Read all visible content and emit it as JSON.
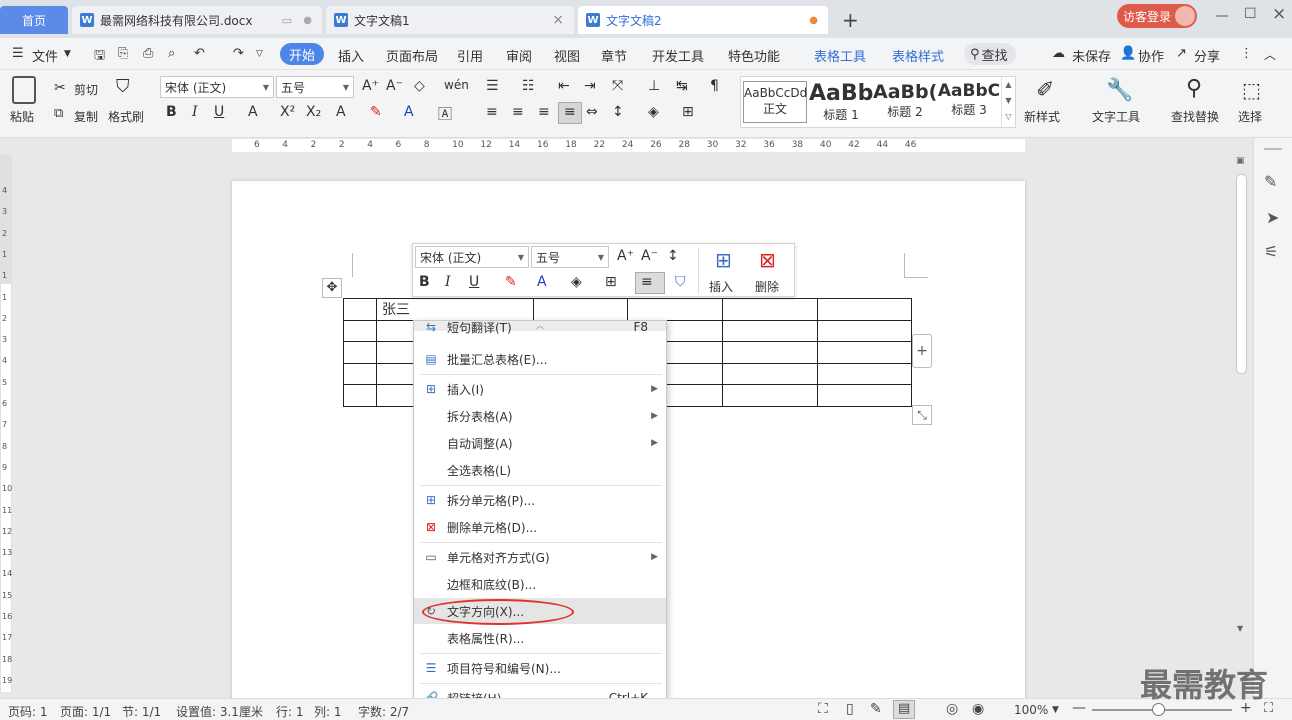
{
  "tabs": {
    "home": "首页",
    "tab1": "最需网络科技有限公司.docx",
    "tab2": "文字文稿1",
    "tab3": "文字文稿2",
    "new_tab": "+",
    "login": "访客登录"
  },
  "menu": {
    "file": "文件",
    "start": "开始",
    "insert": "插入",
    "layout": "页面布局",
    "ref": "引用",
    "review": "审阅",
    "view": "视图",
    "section": "章节",
    "dev": "开发工具",
    "special": "特色功能",
    "table_tools": "表格工具",
    "table_style": "表格样式",
    "search": "查找",
    "unsaved": "未保存",
    "collab": "协作",
    "share": "分享"
  },
  "toolbar": {
    "paste": "粘贴",
    "cut": "剪切",
    "copy": "复制",
    "format_painter": "格式刷",
    "font": "宋体 (正文)",
    "size": "五号",
    "style_normal_preview": "AaBbCcDd",
    "style_normal": "正文",
    "style_h1_preview": "AaBb",
    "style_h1": "标题 1",
    "style_h2_preview": "AaBb(",
    "style_h2": "标题 2",
    "style_h3_preview": "AaBbC",
    "style_h3": "标题 3",
    "new_style": "新样式",
    "text_tools": "文字工具",
    "find_replace": "查找替换",
    "select": "选择"
  },
  "ruler": {
    "ticks": [
      "6",
      "4",
      "2",
      "2",
      "4",
      "6",
      "8",
      "10",
      "12",
      "14",
      "16",
      "18",
      "22",
      "24",
      "26",
      "28",
      "30",
      "32",
      "36",
      "38",
      "40",
      "42",
      "44",
      "46"
    ],
    "vticks": [
      "4",
      "3",
      "2",
      "1",
      "1",
      "1",
      "2",
      "3",
      "4",
      "5",
      "6",
      "7",
      "8",
      "9",
      "10",
      "11",
      "12",
      "13",
      "14",
      "15",
      "16",
      "17",
      "18",
      "19"
    ]
  },
  "document": {
    "cell_text": "张三"
  },
  "floatbar": {
    "font": "宋体 (正文)",
    "size": "五号",
    "insert": "插入",
    "delete": "删除"
  },
  "context_menu": {
    "item0": "短句翻译(T)",
    "item0_shortcut": "F8",
    "item1": "批量汇总表格(E)...",
    "item2": "插入(I)",
    "item3": "拆分表格(A)",
    "item4": "自动调整(A)",
    "item5": "全选表格(L)",
    "item6": "拆分单元格(P)...",
    "item7": "删除单元格(D)...",
    "item8": "单元格对齐方式(G)",
    "item9": "边框和底纹(B)...",
    "item10": "文字方向(X)...",
    "item11": "表格属性(R)...",
    "item12": "项目符号和编号(N)...",
    "item13": "超链接(H)...",
    "item13_shortcut": "Ctrl+K"
  },
  "status": {
    "page_code": "页码: 1",
    "page": "页面: 1/1",
    "section": "节: 1/1",
    "setting": "设置值: 3.1厘米",
    "row": "行: 1",
    "col": "列: 1",
    "words": "字数: 2/7",
    "zoom": "100%"
  },
  "watermark": "最需教育",
  "colors": {
    "accent": "#2f6fd6",
    "home_tab": "#5b8ae8",
    "highlight_ring": "#e0322c",
    "login": "#e05a4a"
  }
}
